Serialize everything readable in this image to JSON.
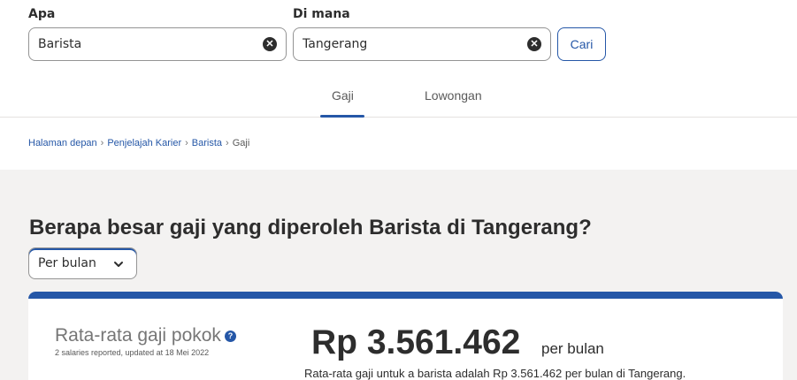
{
  "search": {
    "what_label": "Apa",
    "what_value": "Barista",
    "where_label": "Di mana",
    "where_value": "Tangerang",
    "submit_label": "Cari"
  },
  "tabs": [
    {
      "label": "Gaji",
      "active": true
    },
    {
      "label": "Lowongan",
      "active": false
    }
  ],
  "breadcrumb": [
    "Halaman depan",
    "Penjelajah Karier",
    "Barista",
    "Gaji"
  ],
  "breadcrumb_separator": "›",
  "main": {
    "question": "Berapa besar gaji yang diperoleh Barista di Tangerang?",
    "period_select": "Per bulan"
  },
  "card": {
    "title": "Rata-rata gaji pokok",
    "help": "?",
    "subtitle": "2 salaries reported, updated at 18 Mei 2022",
    "amount": "Rp 3.561.462",
    "period": "per bulan",
    "description": "Rata-rata gaji untuk a barista adalah Rp 3.561.462 per bulan di Tangerang."
  },
  "colors": {
    "accent": "#2557a7",
    "text": "#2d2d2d",
    "muted": "#767676",
    "band": "#f3f2f1"
  },
  "icons": {
    "clear": "clear-circle-icon",
    "chevron": "chevron-down-icon",
    "help": "question-circle-icon"
  }
}
